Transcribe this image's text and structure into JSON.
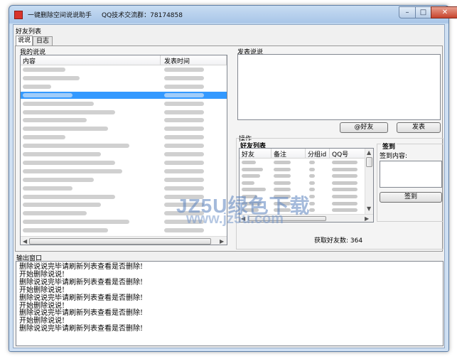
{
  "window": {
    "title": "一键删除空间说说助手",
    "qq_group": "QQ技术交流群：78174858",
    "minimize_icon": "minimize-icon",
    "maximize_icon": "maximize-icon",
    "close_icon": "close-icon",
    "minimize_glyph": "–",
    "maximize_glyph": "□",
    "close_glyph": "✕"
  },
  "menu": {
    "friends_list": "好友列表"
  },
  "tabs": [
    {
      "label": "说说",
      "active": true
    },
    {
      "label": "日志",
      "active": false
    }
  ],
  "my_posts": {
    "label": "我的说说",
    "columns": [
      "内容",
      "发表时间"
    ],
    "selected_row": 3
  },
  "post": {
    "label": "发表说说",
    "at_button": "@好友",
    "send_button": "发表"
  },
  "operations": {
    "label": "操作",
    "friends_label": "好友列表",
    "columns": [
      "好友",
      "备注",
      "分组id",
      "QQ号"
    ],
    "friend_count_text": "获取好友数: 364",
    "sign": {
      "title": "签到",
      "content_label": "签到内容:",
      "button": "签到"
    }
  },
  "watermark": {
    "line1": "JZ5U绿色下载",
    "line2": "www.jz5u.com"
  },
  "output": {
    "label": "输出窗口",
    "lines": [
      "删除说说完毕请刷新列表查看是否删除!",
      "开始删除说说!",
      "删除说说完毕请刷新列表查看是否删除!",
      "开始删除说说!",
      "删除说说完毕请刷新列表查看是否删除!",
      "开始删除说说!",
      "删除说说完毕请刷新列表查看是否删除!",
      "开始删除说说!",
      "删除说说完毕请刷新列表查看是否删除!"
    ]
  },
  "colors": {
    "selection": "#3399ff",
    "frame": "#a9c6e8"
  }
}
